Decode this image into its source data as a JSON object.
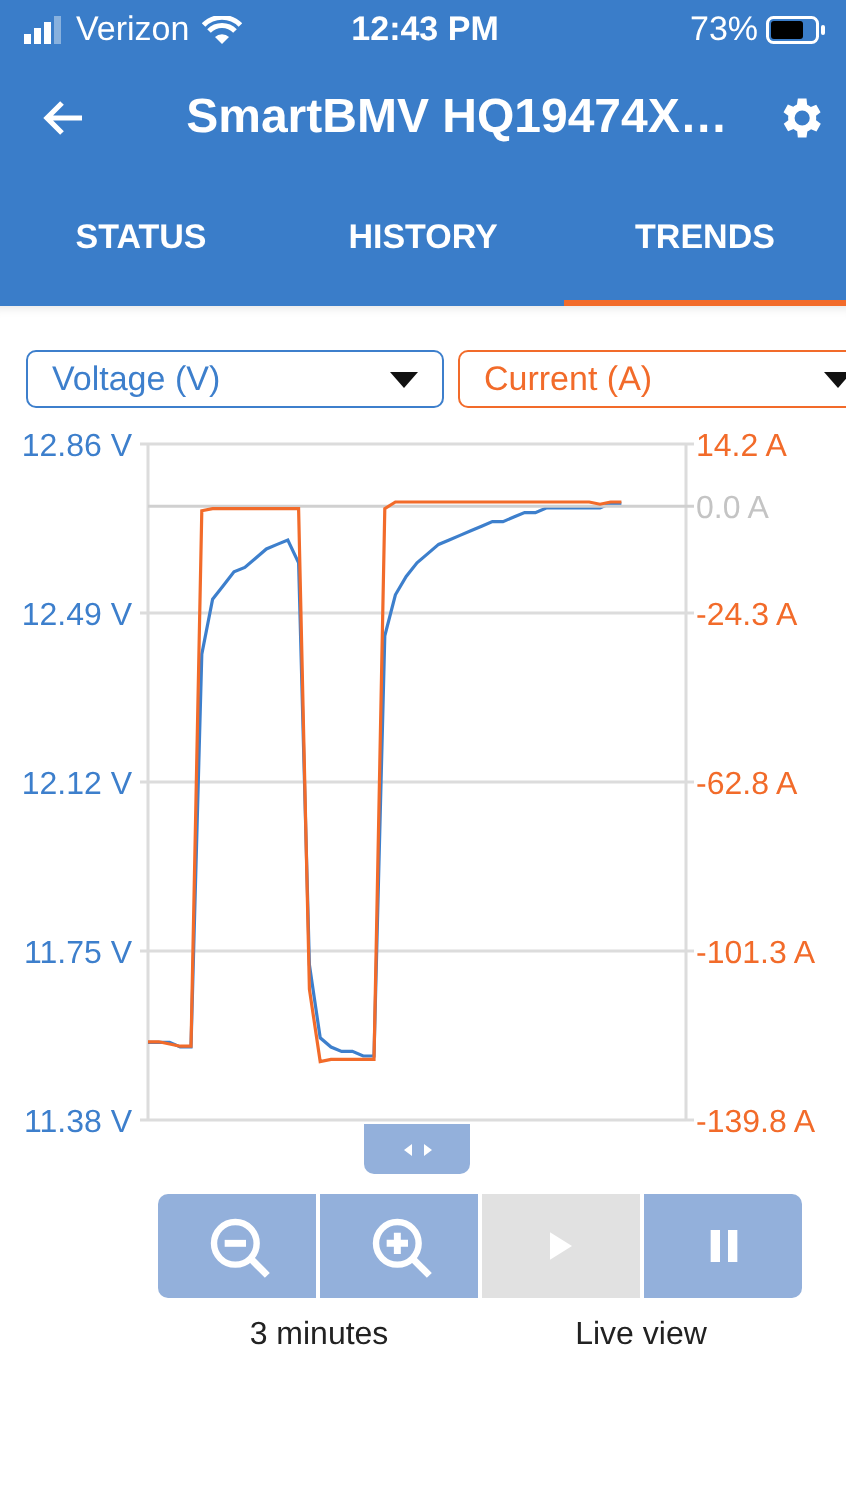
{
  "status_bar": {
    "carrier": "Verizon",
    "time": "12:43 PM",
    "battery": "73%"
  },
  "header": {
    "title": "SmartBMV HQ19474X…"
  },
  "tabs": [
    {
      "label": "STATUS",
      "selected": false
    },
    {
      "label": "HISTORY",
      "selected": false
    },
    {
      "label": "TRENDS",
      "selected": true
    }
  ],
  "selectors": [
    {
      "label": "Voltage (V)",
      "color": "#3d7fcc"
    },
    {
      "label": "Current (A)",
      "color": "#f26b2a"
    }
  ],
  "charts": [
    {
      "chart_data": {
        "type": "line",
        "grid": true,
        "ylim": [
          11.38,
          12.86
        ],
        "yticks": [
          {
            "value": 12.86,
            "label": "12.86 V"
          },
          {
            "value": 12.49,
            "label": "12.49 V"
          },
          {
            "value": 12.12,
            "label": "12.12 V"
          },
          {
            "value": 11.75,
            "label": "11.75 V"
          },
          {
            "value": 11.38,
            "label": "11.38 V"
          }
        ],
        "categories": [
          null,
          null,
          null,
          null,
          null,
          null,
          null,
          null,
          null,
          null,
          null,
          null,
          null,
          null,
          null,
          null,
          null,
          null,
          null,
          null,
          null,
          null,
          null,
          null,
          null,
          null,
          null,
          null,
          null,
          null,
          null,
          null,
          null,
          null,
          null,
          null,
          null,
          null,
          null,
          null,
          null,
          null,
          null,
          null,
          null,
          null,
          null,
          null,
          null,
          null,
          null
        ],
        "series": [
          {
            "color": "#3d7fcc",
            "values": [
              11.55,
              11.55,
              11.55,
              11.54,
              11.54,
              12.4,
              12.52,
              12.55,
              12.58,
              12.59,
              12.61,
              12.63,
              12.64,
              12.65,
              12.6,
              11.72,
              11.56,
              11.54,
              11.53,
              11.53,
              11.52,
              11.52,
              12.44,
              12.53,
              12.57,
              12.6,
              12.62,
              12.64,
              12.65,
              12.66,
              12.67,
              12.68,
              12.69,
              12.69,
              12.7,
              12.71,
              12.71,
              12.72,
              12.72,
              12.72,
              12.72,
              12.72,
              12.72,
              12.73,
              12.73,
              null,
              null,
              null,
              null,
              null,
              null
            ]
          }
        ]
      }
    },
    {
      "chart_data": {
        "type": "line",
        "grid": true,
        "ylim": [
          -139.8,
          14.2
        ],
        "yticks": [
          {
            "value": 14.2,
            "label": "14.2 A"
          },
          {
            "value": 0,
            "label": "0.0 A"
          },
          {
            "value": -24.3,
            "label": "-24.3 A"
          },
          {
            "value": -62.8,
            "label": "-62.8 A"
          },
          {
            "value": -101.3,
            "label": "-101.3 A"
          },
          {
            "value": -139.8,
            "label": "-139.8 A"
          }
        ],
        "categories": [
          null,
          null,
          null,
          null,
          null,
          null,
          null,
          null,
          null,
          null,
          null,
          null,
          null,
          null,
          null,
          null,
          null,
          null,
          null,
          null,
          null,
          null,
          null,
          null,
          null,
          null,
          null,
          null,
          null,
          null,
          null,
          null,
          null,
          null,
          null,
          null,
          null,
          null,
          null,
          null,
          null,
          null,
          null,
          null,
          null,
          null,
          null,
          null,
          null,
          null,
          null
        ],
        "series": [
          {
            "color": "#f26b2a",
            "values": [
              -122,
              -122,
              -122.5,
              -123,
              -123,
              -1,
              -0.5,
              -0.5,
              -0.5,
              -0.5,
              -0.5,
              -0.5,
              -0.5,
              -0.5,
              -0.5,
              -110,
              -126.5,
              -126,
              -126,
              -126,
              -126,
              -126,
              -0.5,
              1,
              1,
              1,
              1,
              1,
              1,
              1,
              1,
              1,
              1,
              1,
              1,
              1,
              1,
              1,
              1,
              1,
              1,
              1,
              0.5,
              1,
              1,
              null,
              null,
              null,
              null,
              null,
              null
            ]
          }
        ]
      }
    }
  ],
  "controls": {
    "buttons": [
      {
        "kind": "zoom_out",
        "disabled": false
      },
      {
        "kind": "zoom_in",
        "disabled": false
      },
      {
        "kind": "play",
        "disabled": true
      },
      {
        "kind": "pause",
        "disabled": false
      }
    ],
    "labels": [
      "3 minutes",
      "Live view"
    ]
  }
}
